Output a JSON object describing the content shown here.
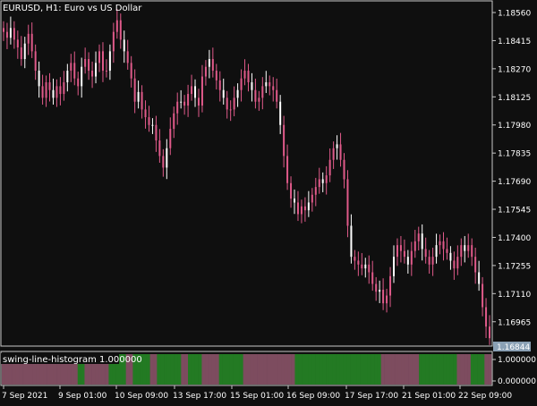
{
  "symbol_title": "EURUSD, H1:  Euro vs US Dollar",
  "indicator_title": "swing-line-histogram 1.000000",
  "colors": {
    "background": "#0f0f0f",
    "frame": "#c8c8c8",
    "candle": "#e05a8a",
    "candle_alt": "#ffffff",
    "hist_green": "#237a23",
    "hist_pink": "#7d4c5f",
    "price_tag_bg": "#8aa0b4",
    "text": "#ffffff"
  },
  "chart_data": [
    {
      "type": "candlestick",
      "title": "EURUSD, H1:  Euro vs US Dollar",
      "ylim": [
        1.16844,
        1.1856
      ],
      "y_ticks": [
        "1.18560",
        "1.18415",
        "1.18270",
        "1.18125",
        "1.17980",
        "1.17835",
        "1.17690",
        "1.17545",
        "1.17400",
        "1.17255",
        "1.17110",
        "1.16965"
      ],
      "current_price": "1.16844",
      "x_ticks": [
        "7 Sep 2021",
        "9 Sep 01:00",
        "10 Sep 09:00",
        "13 Sep 17:00",
        "15 Sep 01:00",
        "16 Sep 09:00",
        "17 Sep 17:00",
        "21 Sep 01:00",
        "22 Sep 09:00"
      ],
      "close": [
        1.1846,
        1.1843,
        1.1848,
        1.1842,
        1.1838,
        1.1832,
        1.184,
        1.1845,
        1.1836,
        1.1826,
        1.1818,
        1.1812,
        1.182,
        1.1816,
        1.1812,
        1.1818,
        1.1814,
        1.182,
        1.1826,
        1.183,
        1.1822,
        1.1818,
        1.1828,
        1.1832,
        1.1826,
        1.1823,
        1.183,
        1.1836,
        1.1826,
        1.1826,
        1.1836,
        1.1846,
        1.1852,
        1.1842,
        1.1836,
        1.183,
        1.1822,
        1.181,
        1.1815,
        1.1806,
        1.1802,
        1.1798,
        1.1798,
        1.179,
        1.1782,
        1.1776,
        1.1786,
        1.1796,
        1.1804,
        1.181,
        1.181,
        1.1808,
        1.1814,
        1.1818,
        1.1812,
        1.1808,
        1.1823,
        1.1828,
        1.1832,
        1.1826,
        1.1821,
        1.1816,
        1.1812,
        1.1806,
        1.1806,
        1.1812,
        1.1816,
        1.1822,
        1.1826,
        1.182,
        1.1816,
        1.181,
        1.1812,
        1.1818,
        1.182,
        1.1818,
        1.1816,
        1.181,
        1.1798,
        1.1782,
        1.1768,
        1.176,
        1.1758,
        1.1752,
        1.1756,
        1.1754,
        1.1758,
        1.1762,
        1.1766,
        1.177,
        1.1768,
        1.1772,
        1.178,
        1.1786,
        1.1788,
        1.178,
        1.177,
        1.1746,
        1.173,
        1.1728,
        1.1726,
        1.1724,
        1.1726,
        1.1722,
        1.1716,
        1.1712,
        1.1713,
        1.1706,
        1.171,
        1.172,
        1.173,
        1.1736,
        1.1733,
        1.173,
        1.1726,
        1.1733,
        1.1738,
        1.1742,
        1.1734,
        1.173,
        1.1726,
        1.173,
        1.1736,
        1.1738,
        1.1734,
        1.1732,
        1.1728,
        1.1724,
        1.173,
        1.1736,
        1.1733,
        1.1736,
        1.173,
        1.1722,
        1.1716,
        1.1704,
        1.1694,
        1.1688
      ],
      "histogram_colors": [
        "pink",
        "pink",
        "pink",
        "pink",
        "pink",
        "pink",
        "pink",
        "pink",
        "pink",
        "pink",
        "pink",
        "pink",
        "pink",
        "pink",
        "pink",
        "pink",
        "pink",
        "pink",
        "pink",
        "pink",
        "pink",
        "pink",
        "green",
        "green",
        "pink",
        "pink",
        "pink",
        "pink",
        "pink",
        "pink",
        "pink",
        "green",
        "green",
        "green",
        "green",
        "green",
        "pink",
        "pink",
        "green",
        "green",
        "green",
        "green",
        "green",
        "pink",
        "pink",
        "green",
        "green",
        "green",
        "green",
        "green",
        "green",
        "green",
        "pink",
        "pink",
        "green",
        "green",
        "green",
        "green",
        "pink",
        "pink",
        "pink",
        "pink",
        "pink",
        "green",
        "green",
        "green",
        "green",
        "green",
        "green",
        "green",
        "pink",
        "pink",
        "pink",
        "pink",
        "pink",
        "pink",
        "pink",
        "pink",
        "pink",
        "pink",
        "pink",
        "pink",
        "pink",
        "pink",
        "pink",
        "green",
        "green",
        "green",
        "green",
        "green",
        "green",
        "green",
        "green",
        "green",
        "green",
        "green",
        "green",
        "green",
        "green",
        "green",
        "green",
        "green",
        "green",
        "green",
        "green",
        "green",
        "green",
        "green",
        "green",
        "green",
        "pink",
        "pink",
        "pink",
        "pink",
        "pink",
        "pink",
        "pink",
        "pink",
        "pink",
        "pink",
        "pink",
        "green",
        "green",
        "green",
        "green",
        "green",
        "green",
        "green",
        "green",
        "green",
        "green",
        "green",
        "pink",
        "pink",
        "pink",
        "pink",
        "green",
        "green",
        "green",
        "green",
        "pink",
        "pink"
      ],
      "histogram_ticks": [
        "0.000000",
        "1.000000"
      ]
    }
  ]
}
